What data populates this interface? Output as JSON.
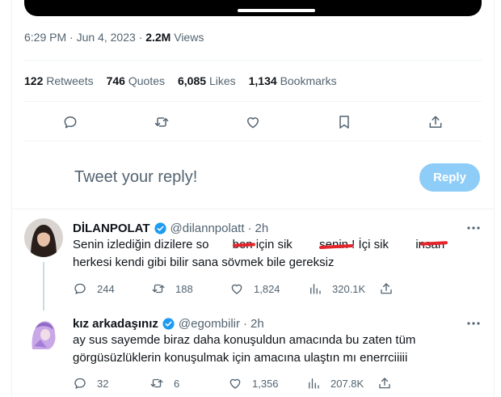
{
  "tweet": {
    "time": "6:29 PM",
    "date": "Jun 4, 2023",
    "views_count": "2.2M",
    "views_label": "Views",
    "retweets_count": "122",
    "retweets_label": "Retweets",
    "quotes_count": "746",
    "quotes_label": "Quotes",
    "likes_count": "6,085",
    "likes_label": "Likes",
    "bookmarks_count": "1,134",
    "bookmarks_label": "Bookmarks"
  },
  "composer": {
    "placeholder": "Tweet your reply!",
    "reply_label": "Reply"
  },
  "replies": [
    {
      "name": "DİLANPOLAT",
      "handle": "@dilannpolatt",
      "time": "2h",
      "line1": "Senin izlediğin dizilere so       ben için sik        senin ! İçi sik        insan",
      "line2": "herkesi kendi gibi bilir sana sövmek bile gereksiz",
      "replies": "244",
      "retweets": "188",
      "likes": "1,824",
      "views": "320.1K"
    },
    {
      "name": "kız arkadaşınız",
      "handle": "@egombilir",
      "time": "2h",
      "line1": "ay sus sayemde biraz daha konuşuldun amacında bu zaten tüm",
      "line2": "görgüsüzlüklerin konuşulmak için amacına ulaştın mı enerrciiiii",
      "replies": "32",
      "retweets": "6",
      "likes": "1,356",
      "views": "207.8K"
    }
  ],
  "colors": {
    "accent": "#1d9bf0",
    "accent_disabled": "#8ecdf8",
    "muted": "#536471",
    "redaction": "#e5242b"
  }
}
